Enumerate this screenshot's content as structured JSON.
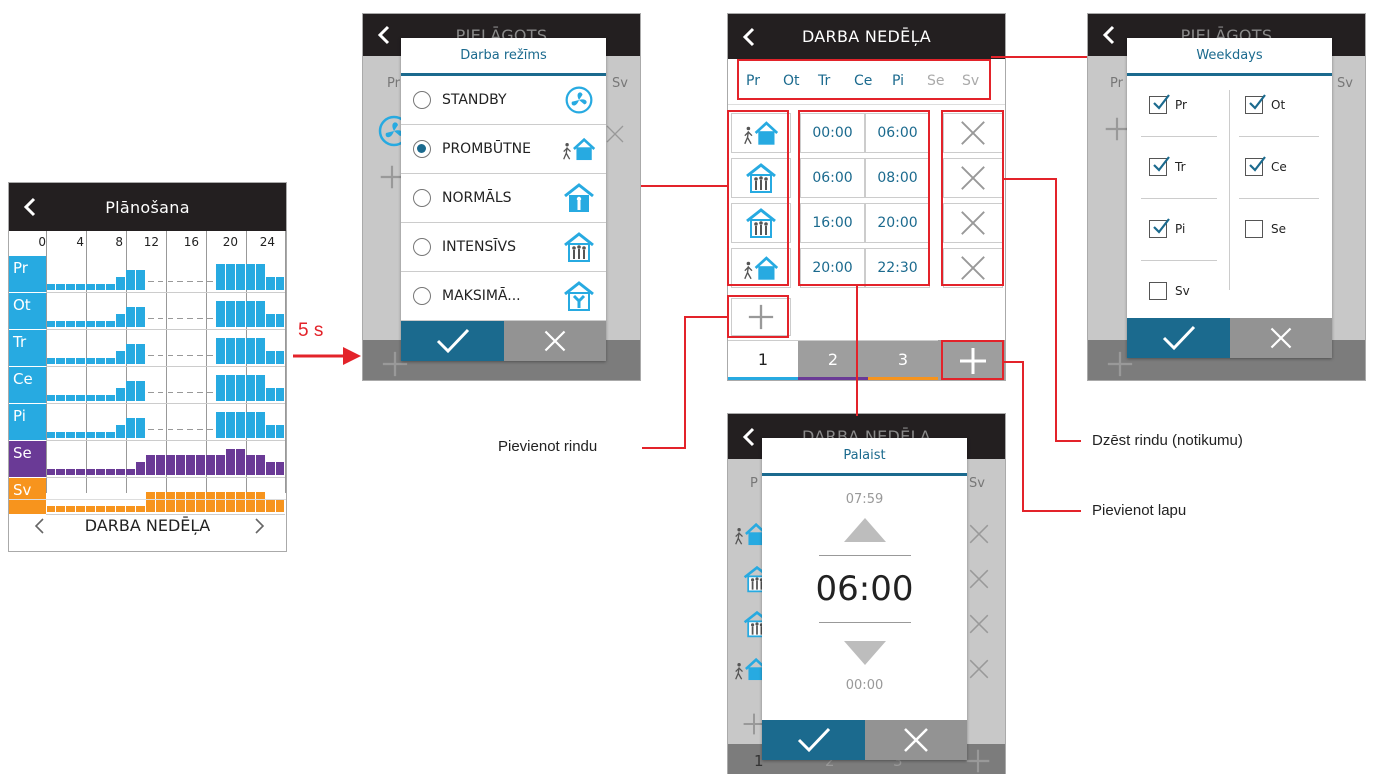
{
  "arrow_label": "5 s",
  "scheduler": {
    "title": "Plānošana",
    "hours": [
      "0",
      "4",
      "8",
      "12",
      "16",
      "20",
      "24"
    ],
    "days": [
      {
        "label": "Pr",
        "color": "#27aae1"
      },
      {
        "label": "Ot",
        "color": "#27aae1"
      },
      {
        "label": "Tr",
        "color": "#27aae1"
      },
      {
        "label": "Ce",
        "color": "#27aae1"
      },
      {
        "label": "Pi",
        "color": "#27aae1"
      },
      {
        "label": "Se",
        "color": "#6a3a96"
      },
      {
        "label": "Sv",
        "color": "#f7941d"
      }
    ],
    "nav_label": "DARBA NEDĒĻA"
  },
  "mode_screen": {
    "bg_title": "PIELĀGOTS",
    "dialog_title": "Darba režīms",
    "options": [
      {
        "label": "STANDBY",
        "selected": false,
        "icon": "fan-icon"
      },
      {
        "label": "PROMBŪTNE",
        "selected": true,
        "icon": "away-house-icon"
      },
      {
        "label": "NORMĀLS",
        "selected": false,
        "icon": "home-person-icon"
      },
      {
        "label": "INTENSĪVS",
        "selected": false,
        "icon": "home-crowd-icon"
      },
      {
        "label": "MAKSIMĀ...",
        "selected": false,
        "icon": "home-fan-icon"
      }
    ],
    "bg_left": "Pr",
    "bg_right": "Sv"
  },
  "week_screen": {
    "title": "DARBA NEDĒĻA",
    "days": [
      {
        "label": "Pr",
        "active": true
      },
      {
        "label": "Ot",
        "active": true
      },
      {
        "label": "Tr",
        "active": true
      },
      {
        "label": "Ce",
        "active": true
      },
      {
        "label": "Pi",
        "active": true
      },
      {
        "label": "Se",
        "active": false
      },
      {
        "label": "Sv",
        "active": false
      }
    ],
    "rows": [
      {
        "mode": "away-house-icon",
        "start": "00:00",
        "end": "06:00"
      },
      {
        "mode": "home-crowd-icon",
        "start": "06:00",
        "end": "08:00"
      },
      {
        "mode": "home-crowd-icon",
        "start": "16:00",
        "end": "20:00"
      },
      {
        "mode": "away-house-icon",
        "start": "20:00",
        "end": "22:30"
      }
    ],
    "pages": [
      {
        "label": "1",
        "color": "#27aae1"
      },
      {
        "label": "2",
        "color": "#6a3a96"
      },
      {
        "label": "3",
        "color": "#f7941d"
      }
    ]
  },
  "weekdays_screen": {
    "bg_title": "PIELĀGOTS",
    "dialog_title": "Weekdays",
    "left": [
      {
        "label": "Pr",
        "checked": true
      },
      {
        "label": "Tr",
        "checked": true
      },
      {
        "label": "Pi",
        "checked": true
      },
      {
        "label": "Sv",
        "checked": false
      }
    ],
    "right": [
      {
        "label": "Ot",
        "checked": true
      },
      {
        "label": "Ce",
        "checked": true
      },
      {
        "label": "Se",
        "checked": false
      }
    ],
    "bg_left": "Pr",
    "bg_right": "Sv"
  },
  "time_screen": {
    "bg_title": "DARBA NEDĒĻA",
    "dialog_title": "Palaist",
    "prev": "07:59",
    "current": "06:00",
    "next": "00:00",
    "bg_left": "P",
    "bg_right": "Sv",
    "bg_page": "1",
    "bg_page2": "2",
    "bg_page3": "3"
  },
  "callouts": {
    "add_row": "Pievienot rindu",
    "delete_row": "Dzēst rindu (notikumu)",
    "add_page": "Pievienot lapu"
  }
}
